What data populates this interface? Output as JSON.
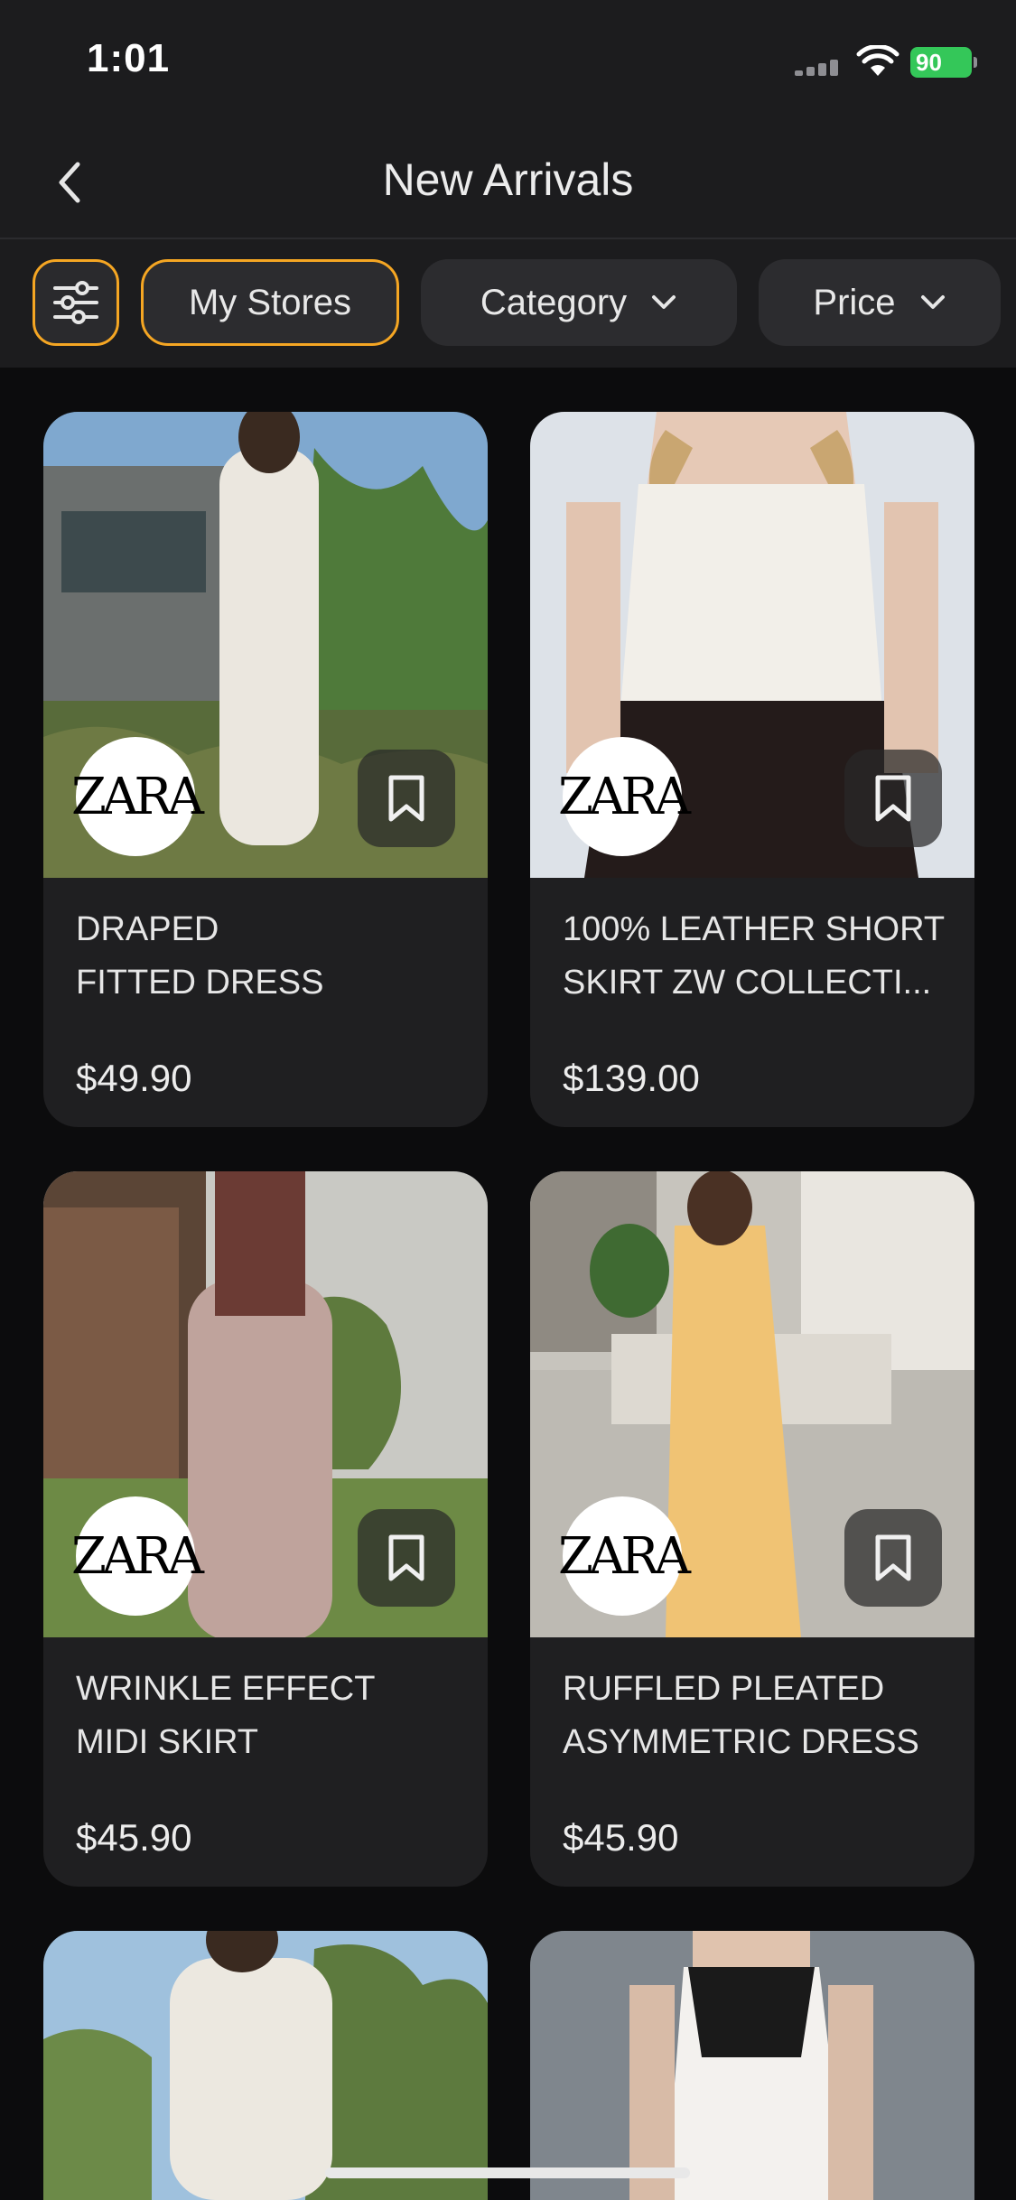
{
  "status_bar": {
    "time": "1:01",
    "battery": "90"
  },
  "header": {
    "title": "New Arrivals"
  },
  "filters": {
    "my_stores": "My Stores",
    "category": "Category",
    "price": "Price"
  },
  "products": [
    {
      "brand": "ZARA",
      "title": "DRAPED\nFITTED DRESS",
      "price": "$49.90"
    },
    {
      "brand": "ZARA",
      "title": "100% LEATHER SHORT\nSKIRT ZW COLLECTI...",
      "price": "$139.00"
    },
    {
      "brand": "ZARA",
      "title": "WRINKLE EFFECT\nMIDI SKIRT",
      "price": "$45.90"
    },
    {
      "brand": "ZARA",
      "title": "RUFFLED PLEATED\nASYMMETRIC DRESS",
      "price": "$45.90"
    }
  ],
  "colors": {
    "accent": "#f5a623",
    "battery": "#34c759",
    "card": "#1f1f21",
    "background": "#0c0c0d"
  }
}
